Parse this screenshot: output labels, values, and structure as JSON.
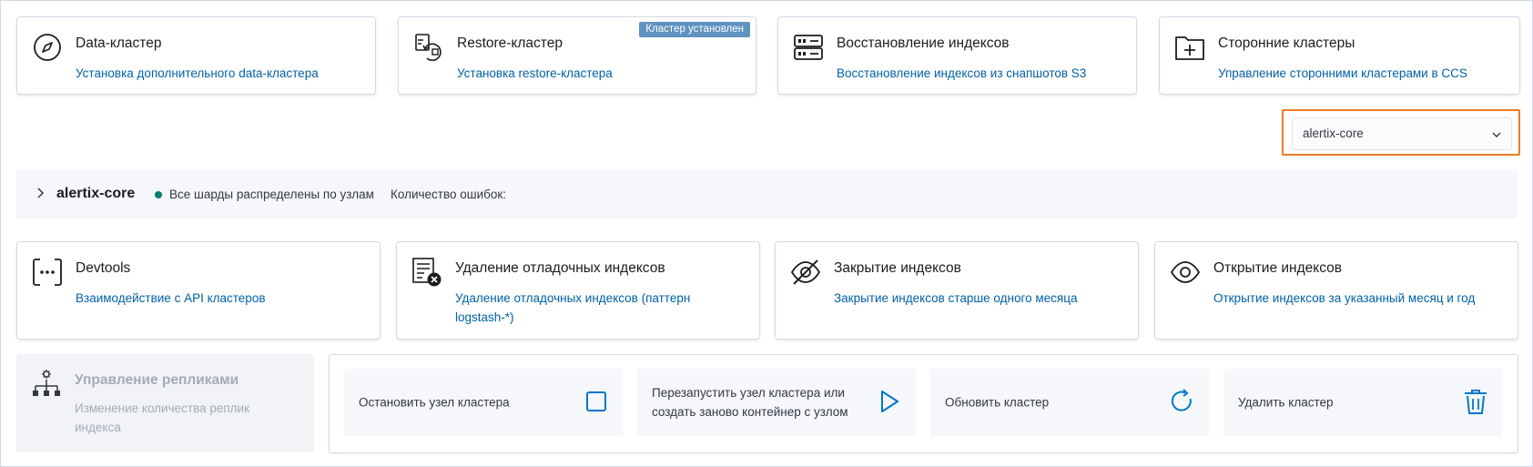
{
  "top_cards": [
    {
      "title": "Data-кластер",
      "link": "Установка дополнительного data-кластера",
      "icon": "compass-icon"
    },
    {
      "title": "Restore-кластер",
      "link": "Установка restore-кластера",
      "icon": "restore-icon",
      "badge": "Кластер установлен"
    },
    {
      "title": "Восстановление индексов",
      "link": "Восстановление индексов из снапшотов S3",
      "icon": "storage-icon"
    },
    {
      "title": "Сторонние кластеры",
      "link": "Управление сторонними кластерами в CCS",
      "icon": "folder-add-icon"
    }
  ],
  "cluster_select": {
    "value": "alertix-core",
    "icon": "chevron-down-icon"
  },
  "cluster_bar": {
    "name": "alertix-core",
    "status": "Все шарды распределены по узлам",
    "status_color": "#017d73",
    "errors_label": "Количество ошибок:"
  },
  "mid_cards": [
    {
      "title": "Devtools",
      "link": "Взаимодействие с API кластеров",
      "icon": "console-icon"
    },
    {
      "title": "Удаление отладочных индексов",
      "link": "Удаление отладочных индексов (паттерн logstash-*)",
      "icon": "list-delete-icon"
    },
    {
      "title": "Закрытие индексов",
      "link": "Закрытие индексов старше одного месяца",
      "icon": "eye-closed-icon"
    },
    {
      "title": "Открытие индексов",
      "link": "Открытие индексов за указанный месяц и год",
      "icon": "eye-icon"
    }
  ],
  "replicas_card": {
    "title": "Управление репликами",
    "link": "Изменение количества реплик индекса",
    "icon": "replicas-icon",
    "disabled": true
  },
  "actions": [
    {
      "label": "Остановить узел кластера",
      "icon": "stop-icon"
    },
    {
      "label": "Перезапустить узел кластера или создать заново контейнер с узлом",
      "icon": "play-icon"
    },
    {
      "label": "Обновить кластер",
      "icon": "refresh-icon"
    },
    {
      "label": "Удалить кластер",
      "icon": "trash-icon"
    }
  ],
  "colors": {
    "link": "#0061a6",
    "accent": "#0077cc",
    "badge": "#6092c0",
    "highlight": "#f07b24"
  }
}
